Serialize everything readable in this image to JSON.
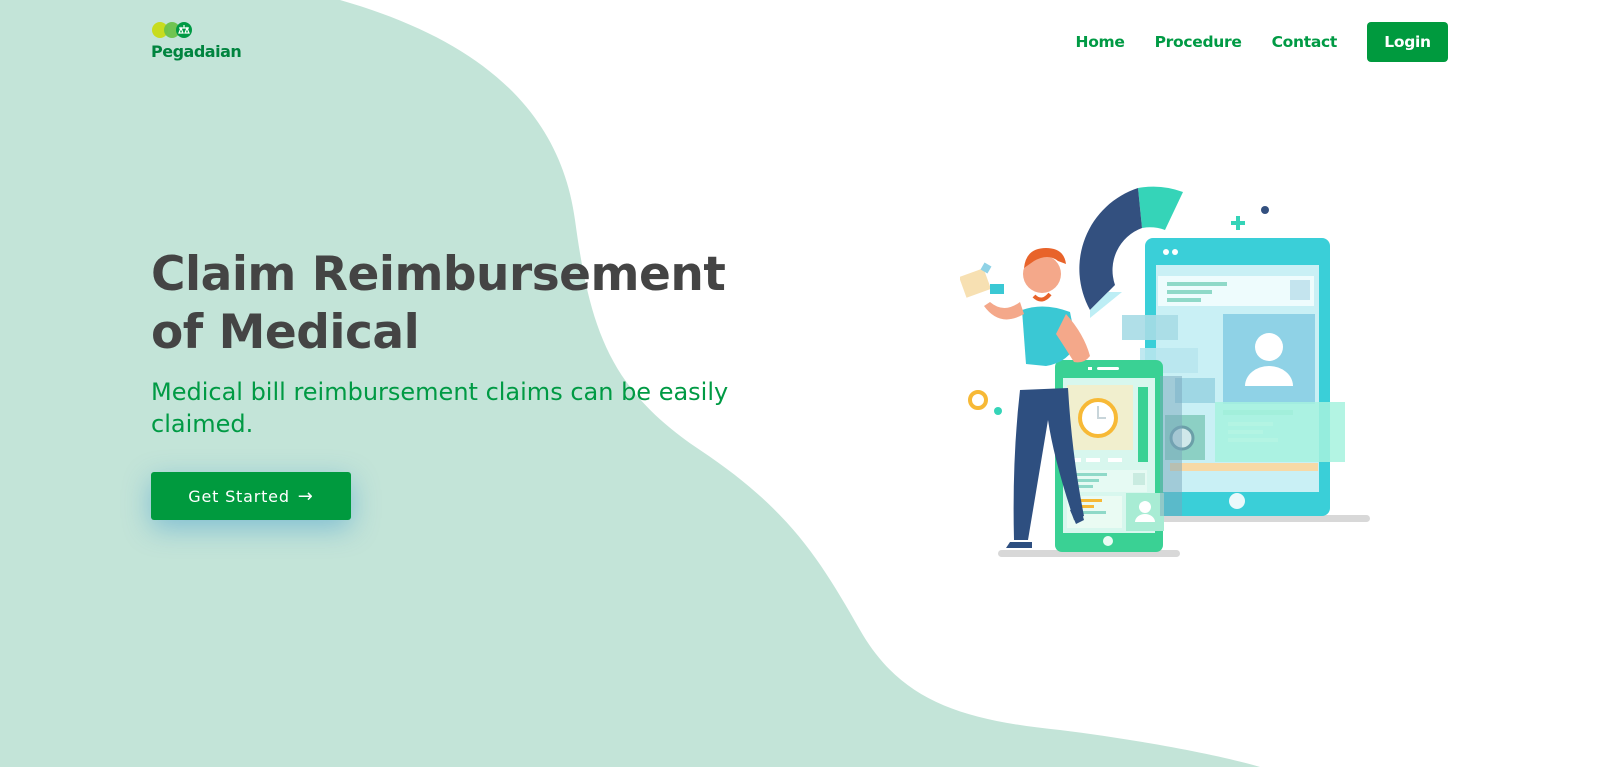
{
  "brand": {
    "name": "Pegadaian"
  },
  "nav": {
    "items": [
      {
        "label": "Home"
      },
      {
        "label": "Procedure"
      },
      {
        "label": "Contact"
      }
    ],
    "login_label": "Login"
  },
  "hero": {
    "title": "Claim Reimbursement of Medical",
    "subtitle": "Medical bill reimbursement claims can be easily claimed.",
    "cta_label": "Get Started",
    "cta_icon": "arrow-right-icon"
  },
  "colors": {
    "brand_green": "#009a3e",
    "blob_green": "#c3e4d8",
    "title_gray": "#444444"
  }
}
